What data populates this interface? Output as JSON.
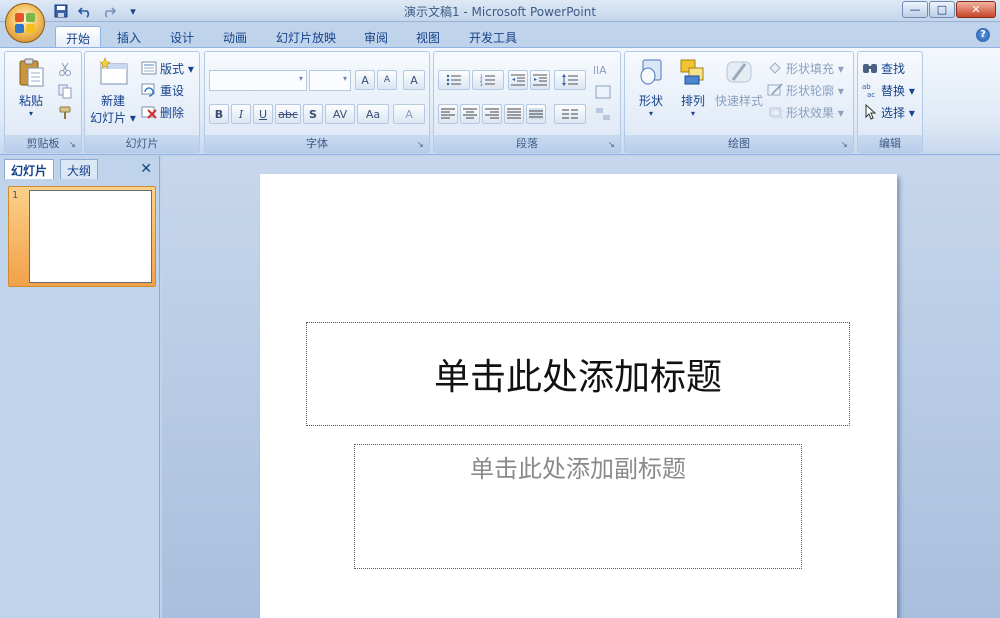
{
  "titlebar": {
    "title": "演示文稿1 - Microsoft PowerPoint",
    "qat_icons": [
      "save-icon",
      "undo-icon",
      "redo-icon",
      "customize-icon"
    ],
    "win_minimize": "—",
    "win_maximize": "□",
    "win_close": "✕"
  },
  "tabs": [
    {
      "label": "开始",
      "active": true
    },
    {
      "label": "插入"
    },
    {
      "label": "设计"
    },
    {
      "label": "动画"
    },
    {
      "label": "幻灯片放映"
    },
    {
      "label": "审阅"
    },
    {
      "label": "视图"
    },
    {
      "label": "开发工具"
    }
  ],
  "help": "?",
  "ribbon": {
    "clipboard": {
      "label": "剪贴板",
      "paste": "粘贴",
      "paste_arrow": "▾"
    },
    "slides": {
      "label": "幻灯片",
      "new_slide_line1": "新建",
      "new_slide_line2": "幻灯片 ▾",
      "layout": "版式 ▾",
      "reset": "重设",
      "delete": "删除"
    },
    "font": {
      "label": "字体",
      "bold": "B",
      "italic": "I",
      "underline": "U",
      "strike": "abc",
      "shadow": "S",
      "spacing": "AV",
      "case": "Aa",
      "color": "A",
      "grow": "A",
      "shrink": "A",
      "clear": "A"
    },
    "paragraph": {
      "label": "段落"
    },
    "drawing": {
      "label": "绘图",
      "shapes": "形状",
      "arrange": "排列",
      "quick_styles": "快速样式",
      "shape_fill": "形状填充 ▾",
      "shape_outline": "形状轮廓 ▾",
      "shape_effects": "形状效果 ▾"
    },
    "editing": {
      "label": "编辑",
      "find": "查找",
      "replace": "替换 ▾",
      "select": "选择 ▾"
    }
  },
  "leftpane": {
    "tab_slides": "幻灯片",
    "tab_outline": "大纲",
    "close": "✕",
    "slide_number": "1"
  },
  "slide": {
    "title_placeholder": "单击此处添加标题",
    "subtitle_placeholder": "单击此处添加副标题"
  },
  "colors": {
    "ribbon_blue": "#bfd3ea",
    "selected_thumb": "#f1a14a",
    "label_text": "#15428b"
  }
}
